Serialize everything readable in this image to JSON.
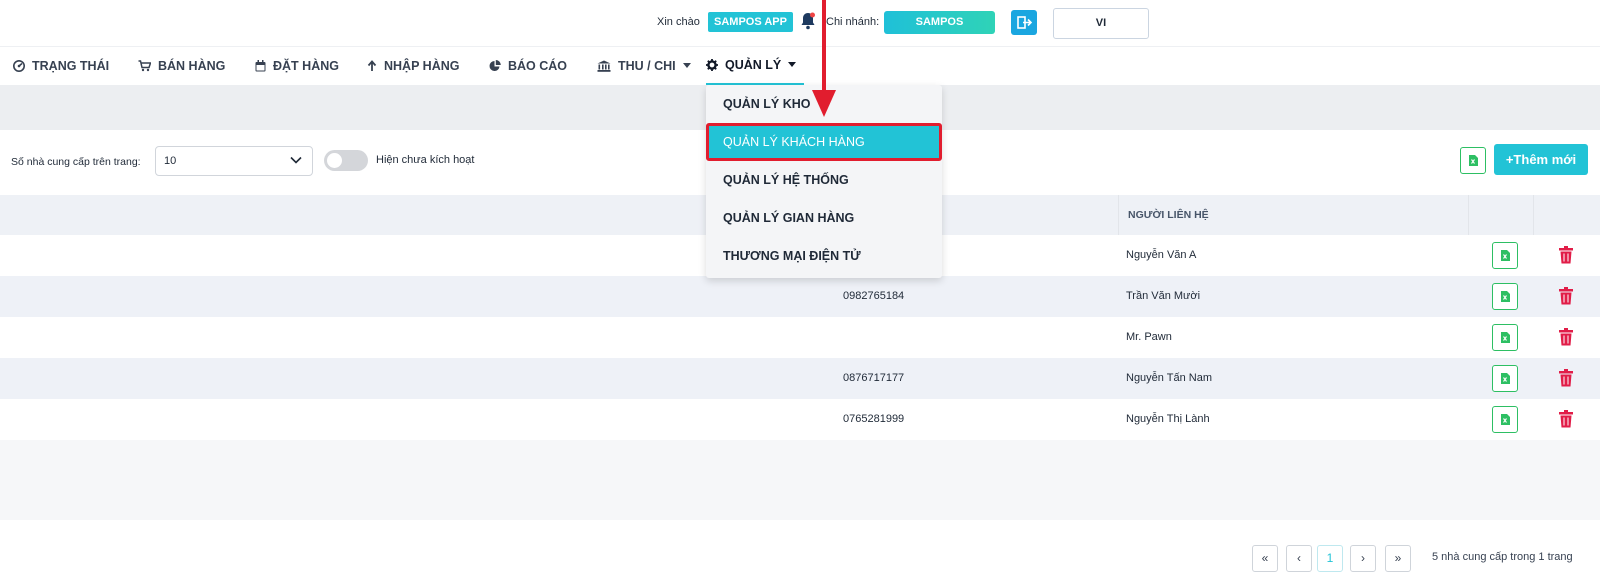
{
  "header": {
    "greeting": "Xin chào",
    "app_name": "SAMPOS APP",
    "branch_label": "Chi nhánh:",
    "branch_name": "SAMPOS",
    "language": "VI"
  },
  "nav": [
    {
      "label": "TRẠNG THÁI",
      "icon": "dashboard-icon"
    },
    {
      "label": "BÁN HÀNG",
      "icon": "cart-icon"
    },
    {
      "label": "ĐẶT HÀNG",
      "icon": "calendar-icon"
    },
    {
      "label": "NHẬP HÀNG",
      "icon": "arrow-up-icon"
    },
    {
      "label": "BÁO CÁO",
      "icon": "pie-chart-icon"
    },
    {
      "label": "THU / CHI",
      "icon": "bank-icon"
    },
    {
      "label": "QUẢN LÝ",
      "icon": "gear-icon"
    }
  ],
  "dropdown": [
    {
      "label": "QUẢN LÝ KHO"
    },
    {
      "label": "QUẢN LÝ KHÁCH HÀNG"
    },
    {
      "label": "QUẢN LÝ HỆ THỐNG"
    },
    {
      "label": "QUẢN LÝ GIAN HÀNG"
    },
    {
      "label": "THƯƠNG MẠI ĐIỆN TỬ"
    }
  ],
  "filters": {
    "per_page_label": "Số nhà cung cấp trên trang:",
    "per_page_value": "10",
    "toggle_label": "Hiện chưa kích hoạt"
  },
  "actions": {
    "add_label": "+Thêm mới"
  },
  "table": {
    "columns": {
      "contact": "NGƯỜI LIÊN HỆ"
    },
    "rows": [
      {
        "phone": "",
        "contact": "Nguyễn Văn A"
      },
      {
        "phone": "0982765184",
        "contact": "Trần Văn Mười"
      },
      {
        "phone": "",
        "contact": "Mr. Pawn"
      },
      {
        "phone": "0876717177",
        "contact": "Nguyễn Tấn Nam"
      },
      {
        "phone": "0765281999",
        "contact": "Nguyễn Thị Lành"
      }
    ]
  },
  "pagination": {
    "current_page": "1",
    "first_symbol": "«",
    "prev_symbol": "‹",
    "next_symbol": "›",
    "last_symbol": "»",
    "summary": "5 nhà cung cấp trong 1 trang"
  },
  "colors": {
    "accent": "#22c3d6",
    "highlight_border": "#e11d2e",
    "delete": "#e11d48",
    "excel": "#2dbf63"
  }
}
